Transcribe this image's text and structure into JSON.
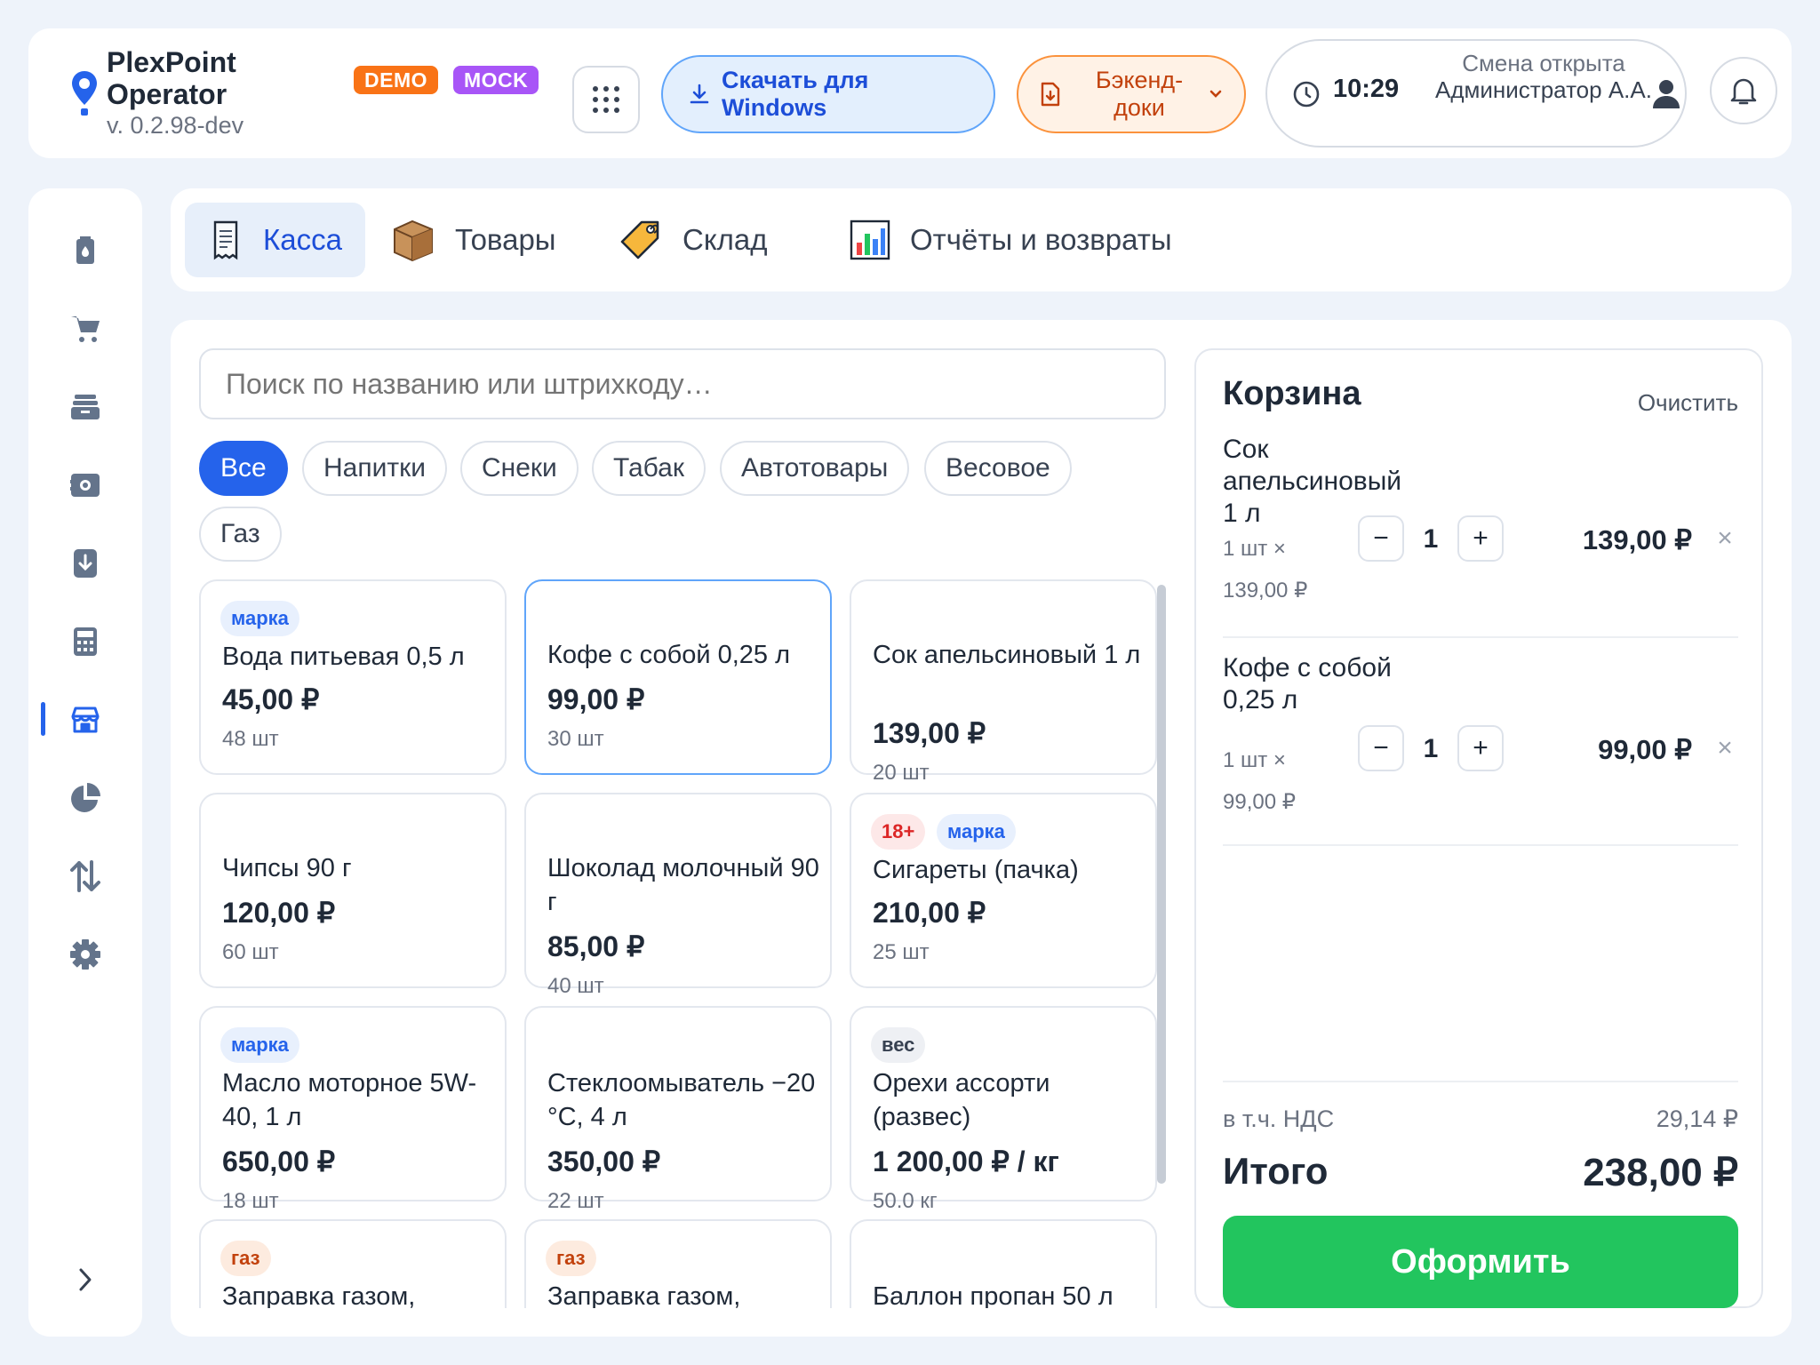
{
  "header": {
    "app_name": "PlexPoint Operator",
    "version": "v. 0.2.98-dev",
    "badges": [
      "DEMO",
      "MOCK"
    ],
    "download_button": "Скачать для Windows",
    "backend_button": "Бэкенд-доки",
    "clock": "10:29",
    "shift_status": "Смена открыта",
    "operator": "Администратор А.А."
  },
  "tabs": [
    {
      "label": "Касса",
      "icon": "receipt-icon",
      "active": true
    },
    {
      "label": "Товары",
      "icon": "box-icon",
      "active": false
    },
    {
      "label": "Склад",
      "icon": "tag-icon",
      "active": false
    },
    {
      "label": "Отчёты и возвраты",
      "icon": "chart-icon",
      "active": false
    }
  ],
  "sidebar": {
    "items": [
      "fuel-icon",
      "cart-icon",
      "inbox-icon",
      "safe-icon",
      "download-icon",
      "calculator-icon",
      "store-icon",
      "pie-chart-icon",
      "sort-icon",
      "settings-icon"
    ],
    "active_index": 6
  },
  "search": {
    "placeholder": "Поиск по названию или штрихкоду…"
  },
  "filters": [
    "Все",
    "Напитки",
    "Снеки",
    "Табак",
    "Автотовары",
    "Весовое",
    "Газ"
  ],
  "products": [
    {
      "tags": [
        "марка"
      ],
      "name": "Вода питьевая 0,5 л",
      "price": "45,00 ₽",
      "stock": "48 шт"
    },
    {
      "tags": [],
      "name": "Кофе с собой 0,25 л",
      "price": "99,00 ₽",
      "stock": "30 шт"
    },
    {
      "tags": [],
      "name": "Сок апельсиновый 1 л",
      "price": "139,00 ₽",
      "stock": "20 шт"
    },
    {
      "tags": [],
      "name": "Чипсы 90 г",
      "price": "120,00 ₽",
      "stock": "60 шт"
    },
    {
      "tags": [],
      "name": "Шоколад молочный 90 г",
      "price": "85,00 ₽",
      "stock": "40 шт"
    },
    {
      "tags": [
        "18+",
        "марка"
      ],
      "name": "Сигареты (пачка)",
      "price": "210,00 ₽",
      "stock": "25 шт"
    },
    {
      "tags": [
        "марка"
      ],
      "name": "Масло моторное 5W-40, 1 л",
      "price": "650,00 ₽",
      "stock": "18 шт"
    },
    {
      "tags": [],
      "name": "Стеклоомыватель −20 °C, 4 л",
      "price": "350,00 ₽",
      "stock": "22 шт"
    },
    {
      "tags": [
        "вес"
      ],
      "name": "Орехи ассорти (развес)",
      "price": "1 200,00 ₽ / кг",
      "stock": "50.0 кг"
    },
    {
      "tags": [
        "газ"
      ],
      "name": "Заправка газом,",
      "price": "",
      "stock": ""
    },
    {
      "tags": [
        "газ"
      ],
      "name": "Заправка газом,",
      "price": "",
      "stock": ""
    },
    {
      "tags": [],
      "name": "Баллон пропан 50 л",
      "price": "",
      "stock": ""
    }
  ],
  "cart": {
    "title": "Корзина",
    "clear": "Очистить",
    "items": [
      {
        "name": "Сок апельсиновый 1 л",
        "unit": "1 шт ×",
        "unit_price": "139,00 ₽",
        "qty": "1",
        "total": "139,00 ₽"
      },
      {
        "name": "Кофе с собой 0,25 л",
        "unit": "1 шт ×",
        "unit_price": "99,00 ₽",
        "qty": "1",
        "total": "99,00 ₽"
      }
    ],
    "qty_minus": "−",
    "qty_plus": "+",
    "remove": "×",
    "vat_label": "в т.ч. НДС",
    "vat_value": "29,14 ₽",
    "total_label": "Итого",
    "total_value": "238,00 ₽",
    "checkout": "Оформить"
  },
  "colors": {
    "accent": "#2563eb",
    "demo_badge": "#f97316",
    "mock_badge": "#a855f7",
    "checkout": "#22c55e",
    "backend_button": "#fb923c"
  }
}
